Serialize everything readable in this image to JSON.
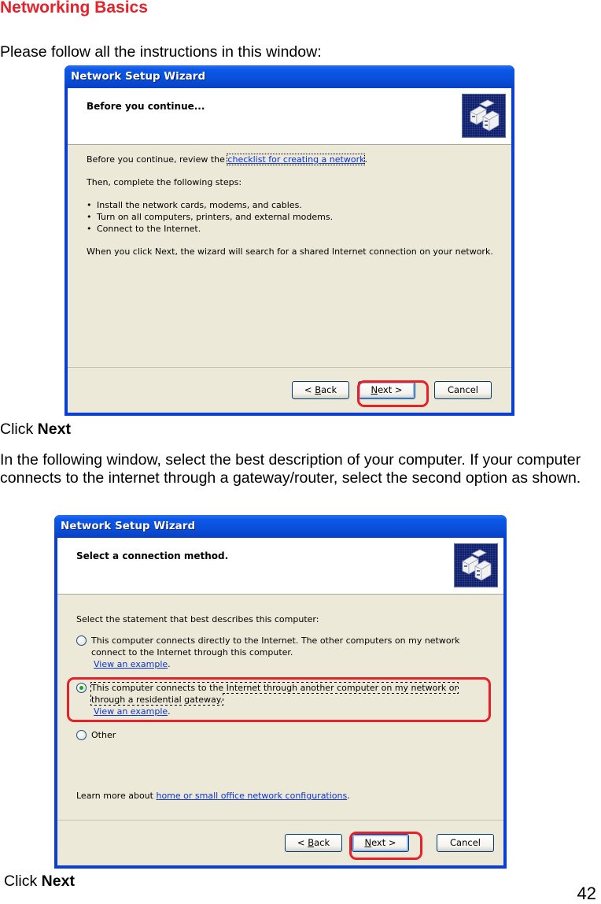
{
  "page": {
    "title": "Networking Basics",
    "intro": "Please follow all the instructions in this window:",
    "click_prefix": "Click",
    "click_target": "Next",
    "description": "In the following window, select the best description of your computer. If your computer connects to the internet through a gateway/router, select the second option as shown.",
    "page_number": "42",
    "highlight_color": "#e8202a"
  },
  "wizard1": {
    "window_title": "Network Setup Wizard",
    "header_title": "Before you continue...",
    "icon": "network-computers-icon",
    "review_prefix": "Before you continue, review the",
    "review_link": "checklist for creating a network",
    "review_suffix": ".",
    "steps_intro": "Then, complete the following steps:",
    "steps": [
      "Install the network cards, modems, and cables.",
      "Turn on all computers, printers, and external modems.",
      "Connect to the Internet."
    ],
    "closing": "When you click Next, the wizard will search for a shared Internet connection on your network.",
    "buttons": {
      "back": "< Back",
      "next": "Next >",
      "cancel": "Cancel"
    }
  },
  "wizard2": {
    "window_title": "Network Setup Wizard",
    "header_title": "Select a connection method.",
    "icon": "network-computers-icon",
    "prompt": "Select the statement that best describes this computer:",
    "options": [
      {
        "label": "This computer connects directly to the Internet. The other computers on my network connect to the Internet through this computer.",
        "link": "View an example",
        "selected": false
      },
      {
        "label": "This computer connects to the Internet through another computer on my network or through a residential gateway.",
        "link": "View an example",
        "selected": true
      },
      {
        "label": "Other",
        "selected": false
      }
    ],
    "learn_prefix": "Learn more about",
    "learn_link": "home or small office network configurations",
    "learn_suffix": ".",
    "buttons": {
      "back": "< Back",
      "next": "Next >",
      "cancel": "Cancel"
    }
  }
}
